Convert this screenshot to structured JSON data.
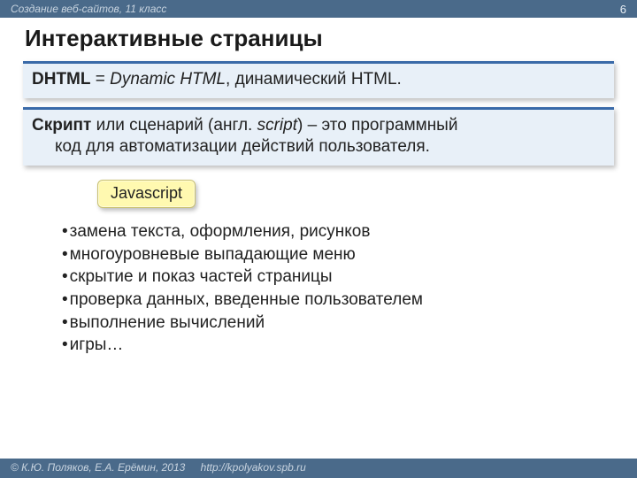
{
  "topbar": {
    "course": "Создание веб-сайтов, 11 класс",
    "page_number": "6"
  },
  "title": "Интерактивные страницы",
  "box1": {
    "bold": "DHTML",
    "eq": " = ",
    "italic": "Dynamic HTML",
    "rest": ", динамический HTML."
  },
  "box2": {
    "bold": "Скрипт",
    "line1_rest": " или сценарий (англ. ",
    "italic": "script",
    "line1_tail": ") – это программный",
    "line2": "код для автоматизации действий пользователя."
  },
  "js_label": "Javascript",
  "bullets": [
    "замена текста, оформления, рисунков",
    "многоуровневые выпадающие меню",
    "скрытие и показ частей страницы",
    "проверка данных, введенные пользователем",
    "выполнение вычислений",
    "игры…"
  ],
  "footer": {
    "copyright": "© К.Ю. Поляков, Е.А. Ерёмин, 2013",
    "url": "http://kpolyakov.spb.ru"
  }
}
